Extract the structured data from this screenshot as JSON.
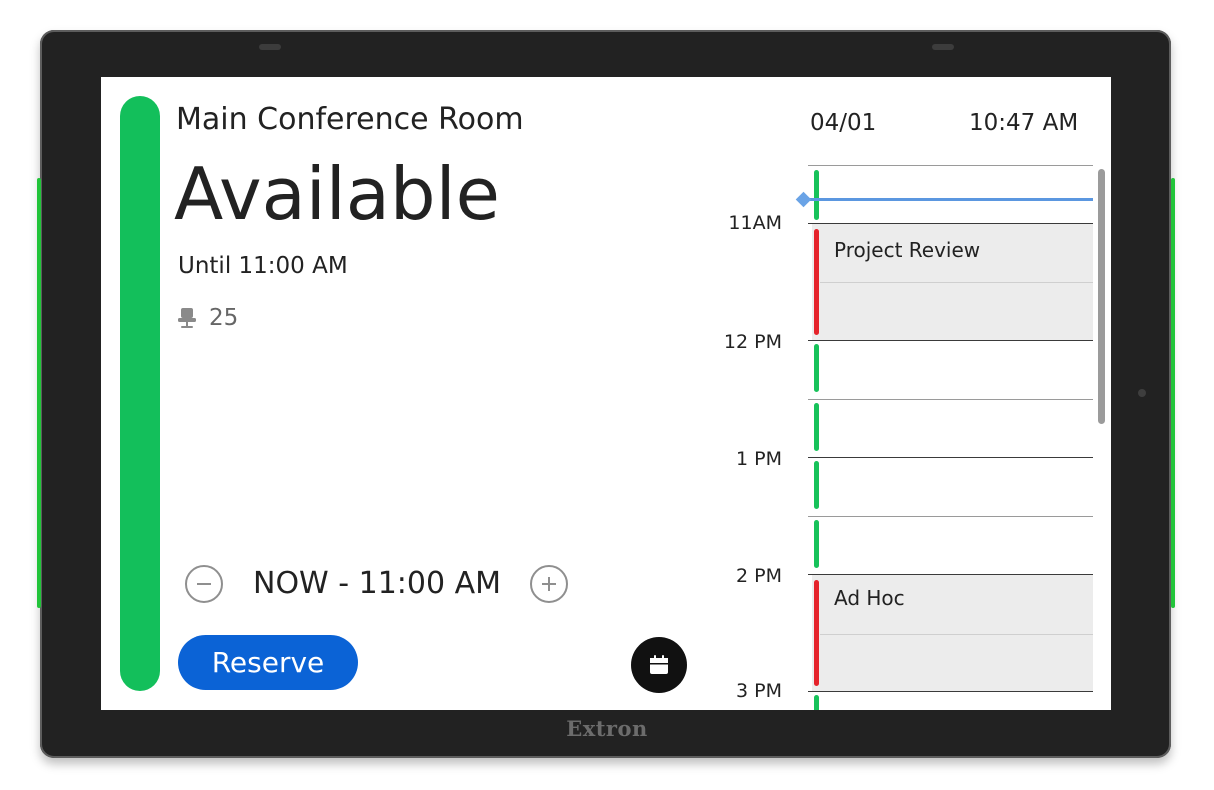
{
  "device": {
    "brand": "Extron"
  },
  "room": {
    "name": "Main Conference Room",
    "status": "Available",
    "until": "Until 11:00 AM",
    "capacity": "25",
    "status_color": "#13bf5b"
  },
  "booking": {
    "range": "NOW - 11:00 AM",
    "reserve_label": "Reserve",
    "accent_color": "#0b63d6"
  },
  "header": {
    "date": "04/01",
    "time": "10:47 AM"
  },
  "schedule": {
    "hour_labels": [
      "11AM",
      "12 PM",
      "1 PM",
      "2 PM",
      "3 PM"
    ],
    "events": [
      {
        "title": "Project Review",
        "status": "busy"
      },
      {
        "title": "Ad Hoc",
        "status": "busy"
      }
    ],
    "free_color": "#17c25a",
    "busy_color": "#e5232b"
  }
}
